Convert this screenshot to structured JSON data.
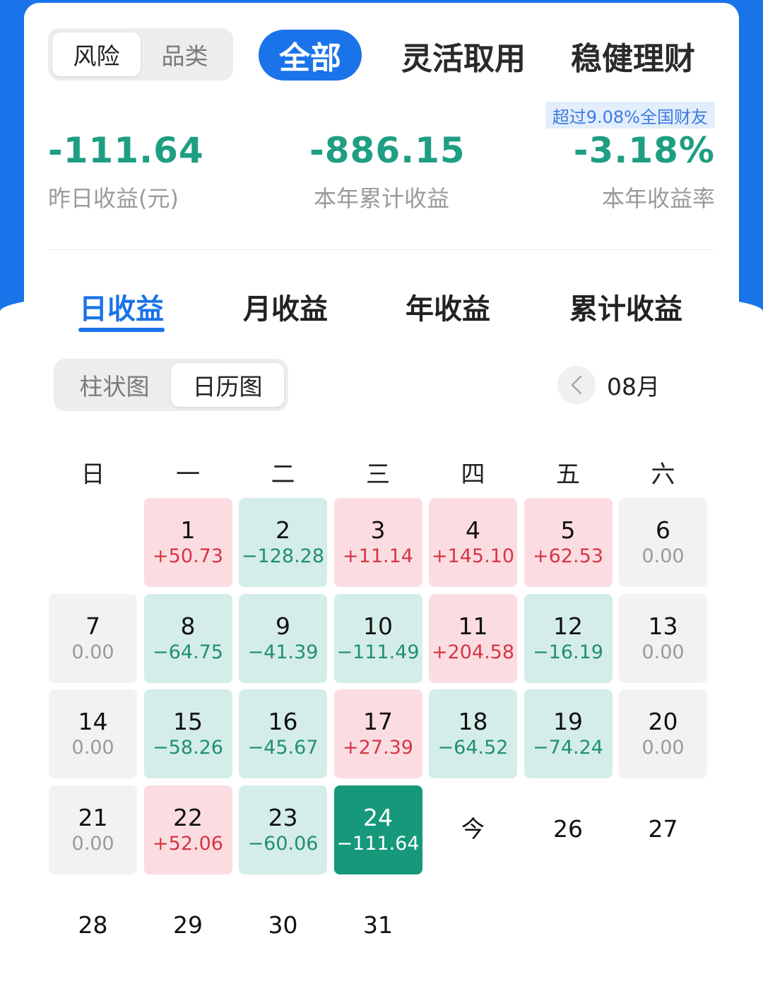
{
  "colors": {
    "brand_blue": "#1a73e8",
    "gain_red": "#d63545",
    "loss_green": "#1f8f77",
    "current_day_green": "#16987b"
  },
  "filter_toggle": {
    "options": [
      "风险",
      "品类"
    ],
    "selected": "风险"
  },
  "categories": {
    "items": [
      "全部",
      "灵活取用",
      "稳健理财"
    ],
    "selected": "全部"
  },
  "rank_badge": "超过9.08%全国财友",
  "stats": {
    "yesterday": {
      "value": "-111.64",
      "label": "昨日收益(元)"
    },
    "year_total": {
      "value": "-886.15",
      "label": "本年累计收益"
    },
    "year_rate": {
      "value": "-3.18%",
      "label": "本年收益率"
    }
  },
  "tabs": {
    "items": [
      "日收益",
      "月收益",
      "年收益",
      "累计收益"
    ],
    "selected": "日收益"
  },
  "view_toggle": {
    "options": [
      "柱状图",
      "日历图"
    ],
    "selected": "日历图"
  },
  "month_nav": {
    "prev_icon": "chevron-left-icon",
    "month": "08月"
  },
  "calendar": {
    "weekdays": [
      "日",
      "一",
      "二",
      "三",
      "四",
      "五",
      "六"
    ],
    "first_weekday_index": 1,
    "days": [
      {
        "day": "1",
        "value": "+50.73",
        "type": "pos"
      },
      {
        "day": "2",
        "value": "−128.28",
        "type": "neg"
      },
      {
        "day": "3",
        "value": "+11.14",
        "type": "pos"
      },
      {
        "day": "4",
        "value": "+145.10",
        "type": "pos"
      },
      {
        "day": "5",
        "value": "+62.53",
        "type": "pos"
      },
      {
        "day": "6",
        "value": "0.00",
        "type": "zero"
      },
      {
        "day": "7",
        "value": "0.00",
        "type": "zero"
      },
      {
        "day": "8",
        "value": "−64.75",
        "type": "neg"
      },
      {
        "day": "9",
        "value": "−41.39",
        "type": "neg"
      },
      {
        "day": "10",
        "value": "−111.49",
        "type": "neg"
      },
      {
        "day": "11",
        "value": "+204.58",
        "type": "pos"
      },
      {
        "day": "12",
        "value": "−16.19",
        "type": "neg"
      },
      {
        "day": "13",
        "value": "0.00",
        "type": "zero"
      },
      {
        "day": "14",
        "value": "0.00",
        "type": "zero"
      },
      {
        "day": "15",
        "value": "−58.26",
        "type": "neg"
      },
      {
        "day": "16",
        "value": "−45.67",
        "type": "neg"
      },
      {
        "day": "17",
        "value": "+27.39",
        "type": "pos"
      },
      {
        "day": "18",
        "value": "−64.52",
        "type": "neg"
      },
      {
        "day": "19",
        "value": "−74.24",
        "type": "neg"
      },
      {
        "day": "20",
        "value": "0.00",
        "type": "zero"
      },
      {
        "day": "21",
        "value": "0.00",
        "type": "zero"
      },
      {
        "day": "22",
        "value": "+52.06",
        "type": "pos"
      },
      {
        "day": "23",
        "value": "−60.06",
        "type": "neg"
      },
      {
        "day": "24",
        "value": "−111.64",
        "type": "current"
      },
      {
        "day": "今",
        "value": "",
        "type": "today"
      },
      {
        "day": "26",
        "value": "",
        "type": "plain"
      },
      {
        "day": "27",
        "value": "",
        "type": "plain"
      },
      {
        "day": "28",
        "value": "",
        "type": "plain"
      },
      {
        "day": "29",
        "value": "",
        "type": "plain"
      },
      {
        "day": "30",
        "value": "",
        "type": "plain"
      },
      {
        "day": "31",
        "value": "",
        "type": "plain"
      }
    ]
  }
}
